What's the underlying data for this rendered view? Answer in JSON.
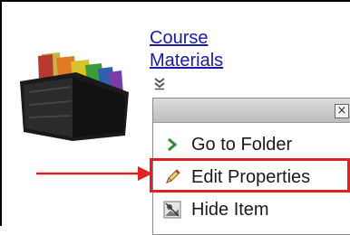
{
  "folder": {
    "title_line1": "Course",
    "title_line2": "Materials"
  },
  "menu": {
    "close_label": "×",
    "items": [
      {
        "label": "Go to Folder",
        "icon": "chevron-right-icon"
      },
      {
        "label": "Edit Properties",
        "icon": "pencil-icon"
      },
      {
        "label": "Hide Item",
        "icon": "hide-item-icon"
      }
    ]
  },
  "colors": {
    "link": "#1a1aa6",
    "annotation": "#e32020",
    "menu_icon_green": "#2e8b2e"
  }
}
